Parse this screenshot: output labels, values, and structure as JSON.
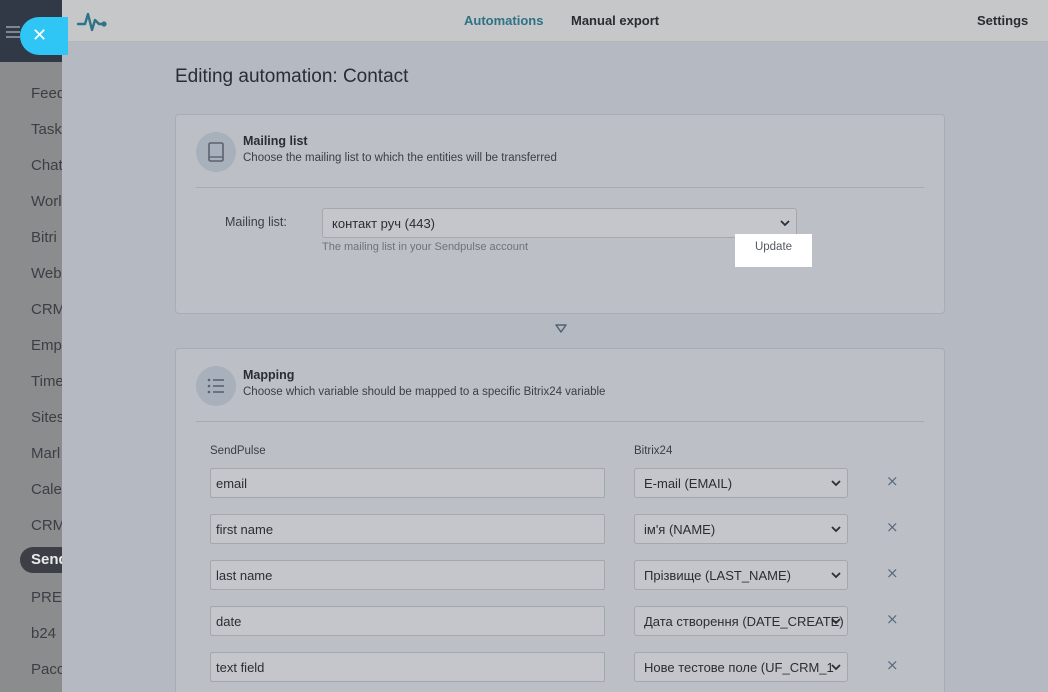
{
  "sidebar": {
    "items": [
      "Feed",
      "Tasks",
      "Chat",
      "Workgroups",
      "Bitrix",
      "Webhooks",
      "CRM",
      "Employees",
      "Time",
      "Sites",
      "Marketing",
      "Calendar",
      "CRM",
      "SendPulse",
      "PRE",
      "b24",
      "Pacc"
    ],
    "visible_labels": [
      "Feed",
      "Task",
      "Chat",
      "Worl",
      "Bitri",
      "Web",
      "CRM",
      "Emp",
      "Time",
      "Sites",
      "Marl",
      "Cale",
      "CRM",
      "Send",
      "PRE",
      "b24",
      "Pacc"
    ],
    "active_index": 13,
    "close_symbol": "✕"
  },
  "topbar": {
    "logo": "pulse-logo-icon",
    "nav": {
      "automations": "Automations",
      "manual_export": "Manual export",
      "settings": "Settings"
    },
    "accent_color": "#2e7285"
  },
  "page": {
    "title": "Editing automation: Contact"
  },
  "mailing_card": {
    "icon": "book-icon",
    "title": "Mailing list",
    "description": "Choose the mailing list to which the entities will be transferred",
    "field_label": "Mailing list:",
    "selected": "контакт руч (443)",
    "help": "The mailing list in your Sendpulse account",
    "update_label": "Update"
  },
  "mapping_card": {
    "icon": "list-icon",
    "title": "Mapping",
    "description": "Choose which variable should be mapped to a specific Bitrix24 variable",
    "col_sendpulse": "SendPulse",
    "col_bitrix": "Bitrix24",
    "remove_symbol": "×",
    "rows": [
      {
        "sendpulse": "email",
        "bitrix": "E-mail (EMAIL)"
      },
      {
        "sendpulse": "first name",
        "bitrix": "ім'я (NAME)"
      },
      {
        "sendpulse": "last name",
        "bitrix": "Прізвище (LAST_NAME)"
      },
      {
        "sendpulse": "date",
        "bitrix": "Дата створення (DATE_CREATE)"
      },
      {
        "sendpulse": "text field",
        "bitrix": "Нове тестове поле (UF_CRM_1"
      }
    ]
  }
}
